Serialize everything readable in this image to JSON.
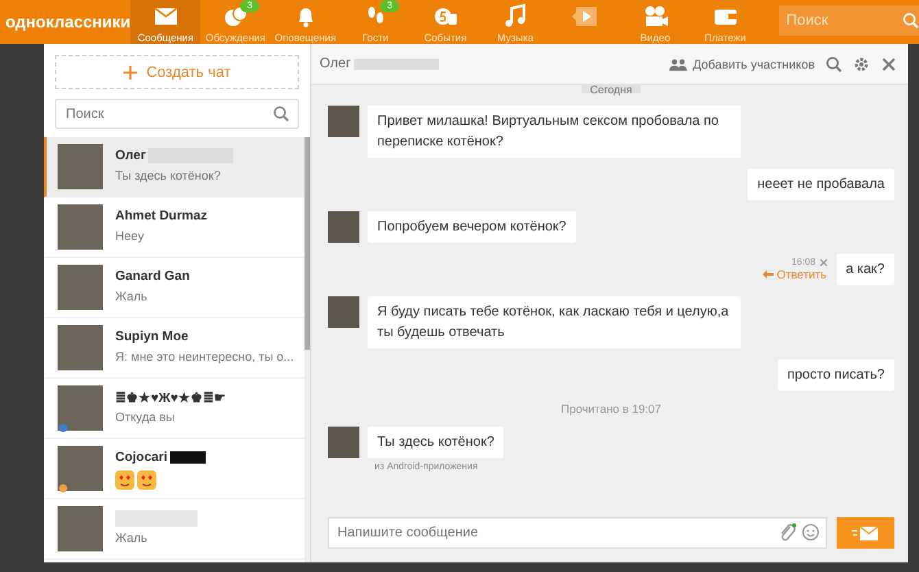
{
  "topbar": {
    "logo": "одноклассники",
    "nav": [
      {
        "label": "Сообщения",
        "selected": true
      },
      {
        "label": "Обсуждения",
        "selected": false,
        "badge": "3"
      },
      {
        "label": "Оповещения",
        "selected": false
      },
      {
        "label": "Гости",
        "selected": false,
        "badge": "3"
      },
      {
        "label": "События",
        "selected": false
      },
      {
        "label": "Музыка",
        "selected": false
      },
      {
        "selected": false
      },
      {
        "label": "Видео",
        "selected": false
      },
      {
        "label": "Платежи",
        "selected": false
      }
    ],
    "search": {
      "placeholder": "Поиск"
    }
  },
  "sidebar": {
    "create_button": "Создать чат",
    "search": {
      "placeholder": "Поиск"
    },
    "chats": [
      {
        "name": "Олег",
        "name_blurred": true,
        "preview": "Ты здесь котёнок?",
        "selected": true
      },
      {
        "name": "Ahmet Durmaz",
        "preview": "Heey",
        "selected": false
      },
      {
        "name": "Ganard Gan",
        "preview": "Жаль",
        "selected": false
      },
      {
        "name": "Supiyn Moe",
        "preview": "Я: мне это неинтересно, ты о...",
        "selected": false
      },
      {
        "name": "≣♚★♥Ж♥★♚≣☛",
        "preview": "Откуда вы",
        "selected": false,
        "color": "#3b7fd0"
      },
      {
        "name": "Cojocari",
        "name_redacted": true,
        "kind": "emoji",
        "selected": false,
        "color": "#f0a040"
      },
      {
        "name_blurred": true,
        "preview": "Жаль",
        "selected": false
      }
    ]
  },
  "chat": {
    "title": "Олег",
    "add_members": "Добавить участников",
    "date": "Сегодня",
    "messages": [
      {
        "kind": "incoming",
        "text": "Привет милашка! Виртуальным сексом пробовала по переписке котёнок?"
      },
      {
        "kind": "outgoing",
        "text": "нееет не пробавала"
      },
      {
        "kind": "incoming",
        "text": "Попробуем вечером котёнок?"
      },
      {
        "kind": "outgoing",
        "text": "а как?",
        "time": "16:08",
        "reply": "Ответить"
      },
      {
        "kind": "incoming",
        "text": "Я буду писать тебе котёнок, как ласкаю тебя и целую,а ты будешь отвечать"
      },
      {
        "kind": "outgoing",
        "text": "просто писать?"
      },
      {
        "kind": "notice",
        "text": "Прочитано в 19:07"
      },
      {
        "kind": "incoming",
        "text": "Ты здесь котёнок?",
        "source": "из Android-приложения"
      }
    ],
    "input": {
      "placeholder": "Напишите сообщение"
    }
  }
}
